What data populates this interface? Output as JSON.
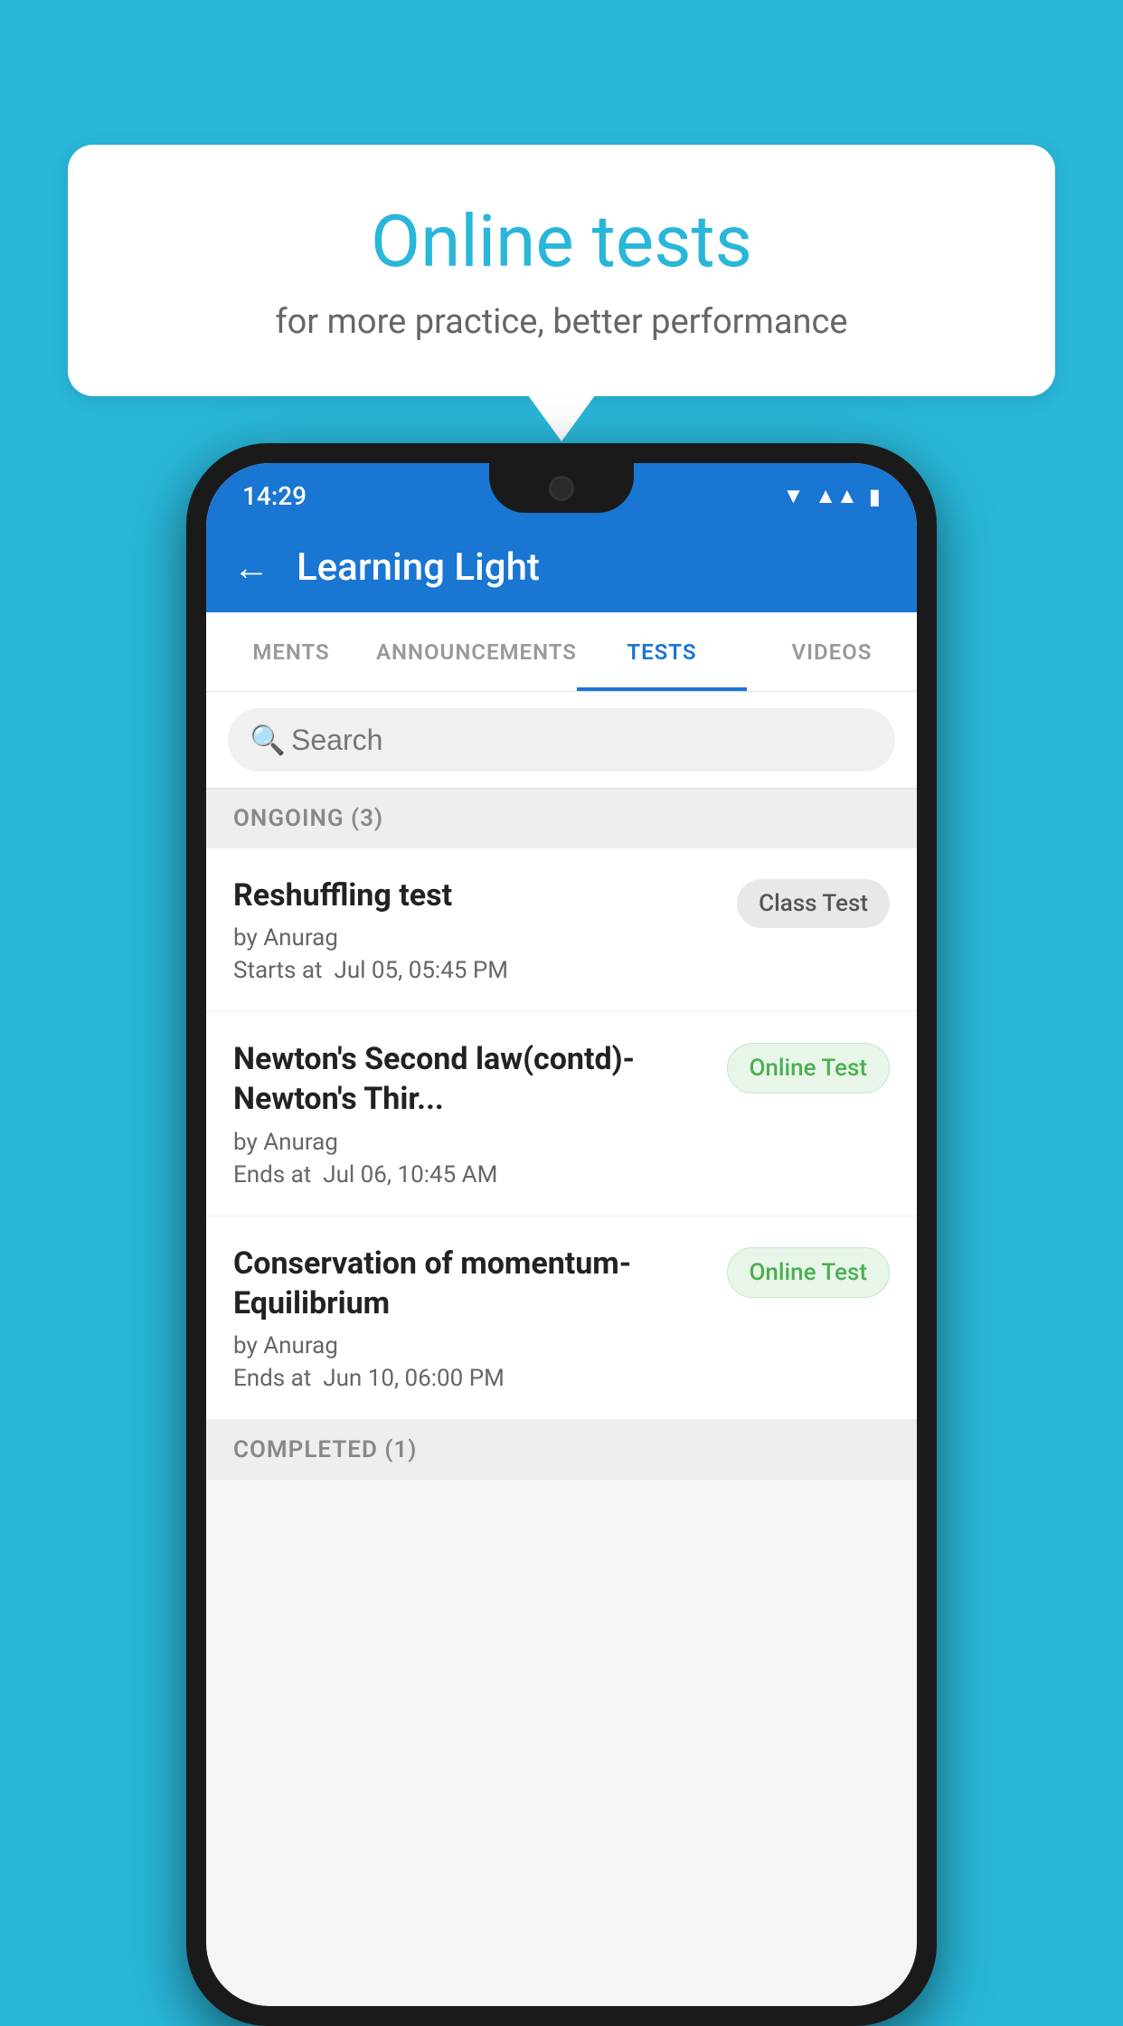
{
  "background": {
    "color": "#29b6d8"
  },
  "speechBubble": {
    "title": "Online tests",
    "subtitle": "for more practice, better performance"
  },
  "phone": {
    "statusBar": {
      "time": "14:29",
      "wifiIcon": "▾",
      "signalIcon": "▲",
      "batteryIcon": "▮"
    },
    "header": {
      "backLabel": "←",
      "title": "Learning Light"
    },
    "tabs": [
      {
        "label": "MENTS",
        "active": false
      },
      {
        "label": "ANNOUNCEMENTS",
        "active": false
      },
      {
        "label": "TESTS",
        "active": true
      },
      {
        "label": "VIDEOS",
        "active": false
      }
    ],
    "search": {
      "placeholder": "Search"
    },
    "ongoingSection": {
      "label": "ONGOING (3)"
    },
    "tests": [
      {
        "name": "Reshuffling test",
        "by": "by Anurag",
        "dateLabel": "Starts at",
        "date": "Jul 05, 05:45 PM",
        "badgeText": "Class Test",
        "badgeType": "class"
      },
      {
        "name": "Newton's Second law(contd)-Newton's Thir...",
        "by": "by Anurag",
        "dateLabel": "Ends at",
        "date": "Jul 06, 10:45 AM",
        "badgeText": "Online Test",
        "badgeType": "online"
      },
      {
        "name": "Conservation of momentum-Equilibrium",
        "by": "by Anurag",
        "dateLabel": "Ends at",
        "date": "Jun 10, 06:00 PM",
        "badgeText": "Online Test",
        "badgeType": "online"
      }
    ],
    "completedSection": {
      "label": "COMPLETED (1)"
    }
  }
}
